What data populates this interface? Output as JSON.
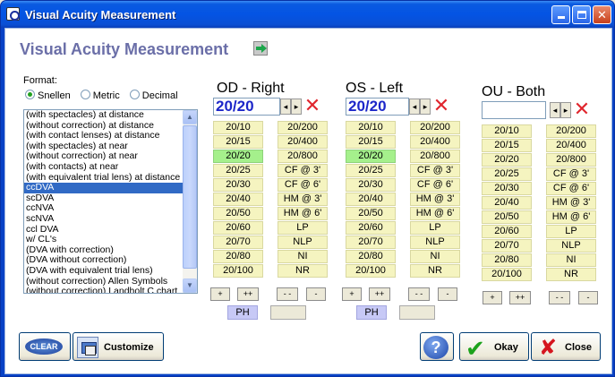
{
  "window": {
    "title": "Visual Acuity Measurement"
  },
  "header": {
    "title": "Visual Acuity Measurement"
  },
  "format": {
    "label": "Format:",
    "options": [
      "Snellen",
      "Metric",
      "Decimal"
    ],
    "selected": "Snellen"
  },
  "conditions": {
    "items": [
      "(with spectacles) at distance",
      "(without correction) at distance",
      "(with contact lenses) at distance",
      "(with spectacles) at near",
      "(without correction) at near",
      "(with contacts) at near",
      "(with equivalent trial lens) at distance",
      "ccDVA",
      "scDVA",
      "ccNVA",
      "scNVA",
      "ccl DVA",
      "w/ CL's",
      "(DVA with correction)",
      "(DVA without correction)",
      "(DVA with equivalent trial lens)",
      "(without correction) Allen Symbols",
      "(without correction) Landholt C chart"
    ],
    "selected_index": 7
  },
  "acuity": {
    "col1": [
      "20/10",
      "20/15",
      "20/20",
      "20/25",
      "20/30",
      "20/40",
      "20/50",
      "20/60",
      "20/70",
      "20/80",
      "20/100"
    ],
    "col2": [
      "20/200",
      "20/400",
      "20/800",
      "CF @ 3'",
      "CF @ 6'",
      "HM @ 3'",
      "HM @ 6'",
      "LP",
      "NLP",
      "NI",
      "NR"
    ]
  },
  "eyes": [
    {
      "key": "od",
      "title": "OD - Right",
      "value": "20/20",
      "selected": "20/20"
    },
    {
      "key": "os",
      "title": "OS - Left",
      "value": "20/20",
      "selected": "20/20"
    },
    {
      "key": "ou",
      "title": "OU - Both",
      "value": "",
      "selected": ""
    }
  ],
  "controls": {
    "plus": "+",
    "plus_plus": "++",
    "minus_minus": "- -",
    "minus": "-",
    "ph": "PH",
    "prev": "◂",
    "next": "▸"
  },
  "buttons": {
    "clear": "CLEAR",
    "customize": "Customize",
    "help": "?",
    "okay": "Okay",
    "close": "Close"
  }
}
